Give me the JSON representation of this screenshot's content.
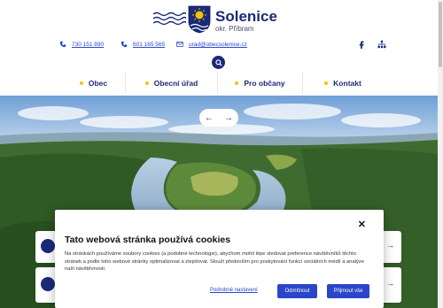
{
  "site": {
    "name": "Solenice",
    "subtitle": "okr. Příbram"
  },
  "contacts": [
    {
      "icon": "phone-icon",
      "text": "730 151 890"
    },
    {
      "icon": "phone-icon",
      "text": "601 165 565"
    },
    {
      "icon": "mail-icon",
      "text": "urad@obecsolenice.cz"
    }
  ],
  "nav": [
    {
      "label": "Obec"
    },
    {
      "label": "Obecní úřad"
    },
    {
      "label": "Pro občany"
    },
    {
      "label": "Kontakt"
    }
  ],
  "slider": {
    "prev": "←",
    "next": "→"
  },
  "cookie": {
    "title": "Tato webová stránka používá cookies",
    "text": "Na stránkách používáme soubory cookies (a podobné technologie), abychom mohli lépe sledovat preference návštěvníků těchto stránek a podle toho webové stránky optimalizovat a zlepšovat. Slouží především pro poskytování funkcí sociálních médií a analýze naší návštěvnosti.",
    "settings": "Podrobné nastavení",
    "decline": "Odmítnout",
    "accept": "Přijmout vše",
    "close": "✕"
  },
  "colors": {
    "brand": "#1b2a78",
    "accent": "#f4c400",
    "link": "#2a46c9"
  }
}
